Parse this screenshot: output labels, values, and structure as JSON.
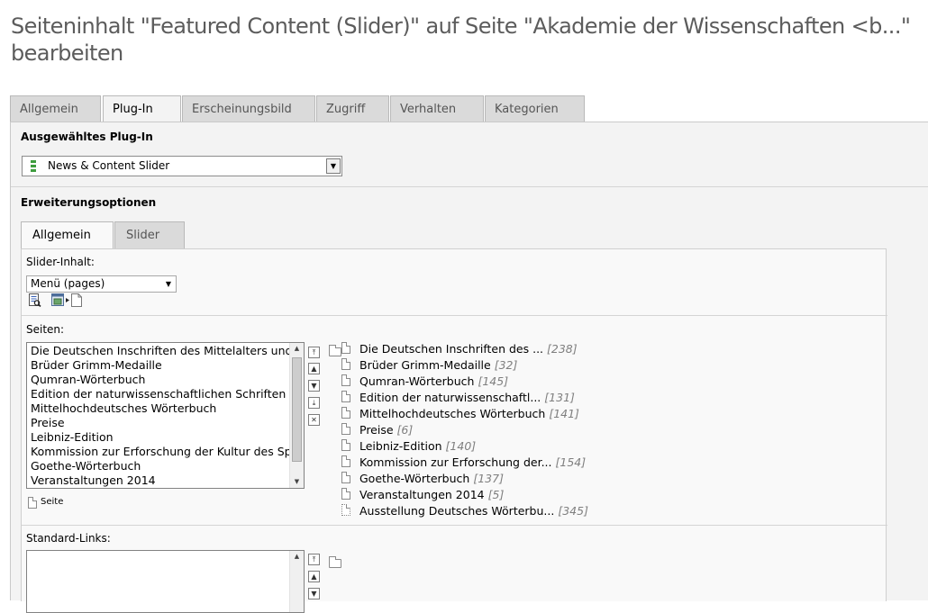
{
  "page_title": "Seiteninhalt \"Featured Content (Slider)\" auf Seite \"Akademie der Wissenschaften <b...\" bearbeiten",
  "main_tabs": [
    "Allgemein",
    "Plug-In",
    "Erscheinungsbild",
    "Zugriff",
    "Verhalten",
    "Kategorien"
  ],
  "active_main_tab": "Plug-In",
  "plugin": {
    "label": "Ausgewähltes Plug-In",
    "selected": "News & Content Slider"
  },
  "extension": {
    "label": "Erweiterungsoptionen",
    "sub_tabs": [
      "Allgemein",
      "Slider"
    ],
    "active_sub_tab": "Allgemein"
  },
  "slider_content": {
    "label": "Slider-Inhalt:",
    "selected": "Menü (pages)"
  },
  "pages": {
    "label": "Seiten:",
    "selected_items": [
      "Die Deutschen Inschriften des Mittelalters und",
      "Brüder Grimm-Medaille",
      "Qumran-Wörterbuch",
      "Edition der naturwissenschaftlichen Schriften",
      "Mittelhochdeutsches Wörterbuch",
      "Preise",
      "Leibniz-Edition",
      "Kommission zur Erforschung der Kultur des Sp",
      "Goethe-Wörterbuch",
      "Veranstaltungen 2014"
    ],
    "legend": "Seite",
    "tree": [
      {
        "title": "Die Deutschen Inschriften des ...",
        "uid": "[238]"
      },
      {
        "title": "Brüder Grimm-Medaille",
        "uid": "[32]"
      },
      {
        "title": "Qumran-Wörterbuch",
        "uid": "[145]"
      },
      {
        "title": "Edition der naturwissenschaftl...",
        "uid": "[131]"
      },
      {
        "title": "Mittelhochdeutsches Wörterbuch",
        "uid": "[141]"
      },
      {
        "title": "Preise",
        "uid": "[6]"
      },
      {
        "title": "Leibniz-Edition",
        "uid": "[140]"
      },
      {
        "title": "Kommission zur Erforschung der...",
        "uid": "[154]"
      },
      {
        "title": "Goethe-Wörterbuch",
        "uid": "[137]"
      },
      {
        "title": "Veranstaltungen 2014",
        "uid": "[5]"
      },
      {
        "title": "Ausstellung Deutsches Wörterbu...",
        "uid": "[345]"
      }
    ]
  },
  "standard_links": {
    "label": "Standard-Links:"
  },
  "icons": {
    "plugin_icon": "green-bars-icon",
    "wizard_edit": "edit-record-icon",
    "wizard_list": "list-records-icon",
    "wizard_add": "new-record-icon",
    "folder": "folder-icon",
    "page": "page-icon"
  }
}
